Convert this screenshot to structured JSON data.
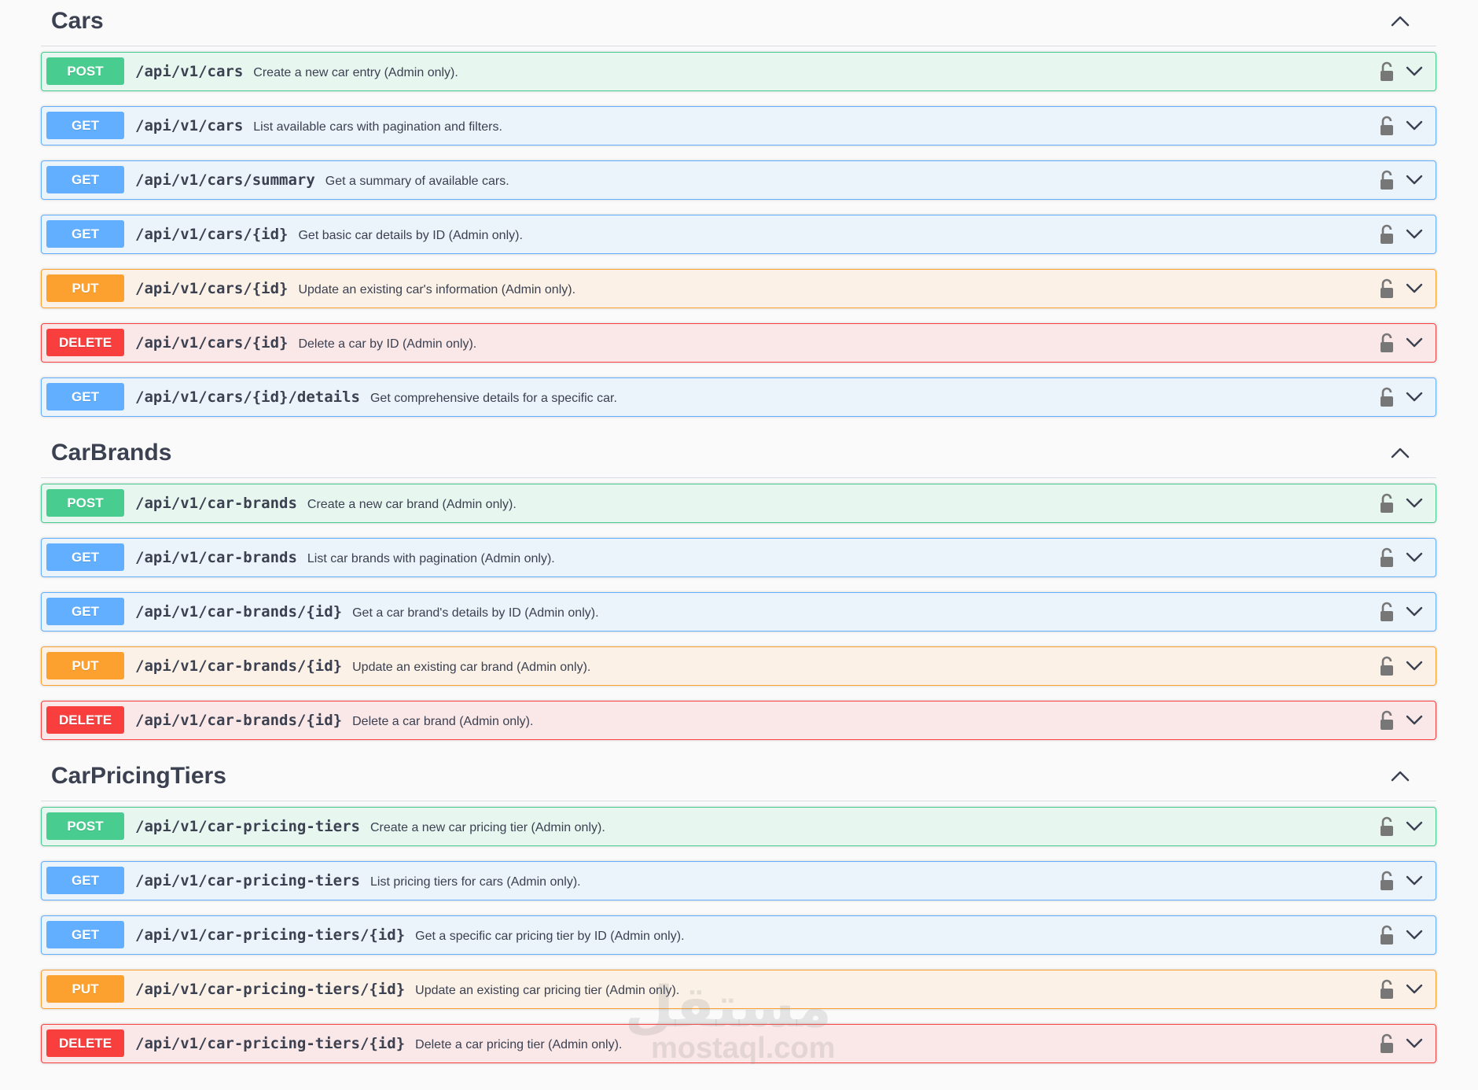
{
  "sections": [
    {
      "title": "Cars",
      "operations": [
        {
          "method": "POST",
          "type": "post",
          "path": "/api/v1/cars",
          "description": "Create a new car entry (Admin only)."
        },
        {
          "method": "GET",
          "type": "get",
          "path": "/api/v1/cars",
          "description": "List available cars with pagination and filters."
        },
        {
          "method": "GET",
          "type": "get",
          "path": "/api/v1/cars/summary",
          "description": "Get a summary of available cars."
        },
        {
          "method": "GET",
          "type": "get",
          "path": "/api/v1/cars/{id}",
          "description": "Get basic car details by ID (Admin only)."
        },
        {
          "method": "PUT",
          "type": "put",
          "path": "/api/v1/cars/{id}",
          "description": "Update an existing car's information (Admin only)."
        },
        {
          "method": "DELETE",
          "type": "delete",
          "path": "/api/v1/cars/{id}",
          "description": "Delete a car by ID (Admin only)."
        },
        {
          "method": "GET",
          "type": "get",
          "path": "/api/v1/cars/{id}/details",
          "description": "Get comprehensive details for a specific car."
        }
      ]
    },
    {
      "title": "CarBrands",
      "operations": [
        {
          "method": "POST",
          "type": "post",
          "path": "/api/v1/car-brands",
          "description": "Create a new car brand (Admin only)."
        },
        {
          "method": "GET",
          "type": "get",
          "path": "/api/v1/car-brands",
          "description": "List car brands with pagination (Admin only)."
        },
        {
          "method": "GET",
          "type": "get",
          "path": "/api/v1/car-brands/{id}",
          "description": "Get a car brand's details by ID (Admin only)."
        },
        {
          "method": "PUT",
          "type": "put",
          "path": "/api/v1/car-brands/{id}",
          "description": "Update an existing car brand (Admin only)."
        },
        {
          "method": "DELETE",
          "type": "delete",
          "path": "/api/v1/car-brands/{id}",
          "description": "Delete a car brand (Admin only)."
        }
      ]
    },
    {
      "title": "CarPricingTiers",
      "operations": [
        {
          "method": "POST",
          "type": "post",
          "path": "/api/v1/car-pricing-tiers",
          "description": "Create a new car pricing tier (Admin only)."
        },
        {
          "method": "GET",
          "type": "get",
          "path": "/api/v1/car-pricing-tiers",
          "description": "List pricing tiers for cars (Admin only)."
        },
        {
          "method": "GET",
          "type": "get",
          "path": "/api/v1/car-pricing-tiers/{id}",
          "description": "Get a specific car pricing tier by ID (Admin only)."
        },
        {
          "method": "PUT",
          "type": "put",
          "path": "/api/v1/car-pricing-tiers/{id}",
          "description": "Update an existing car pricing tier (Admin only)."
        },
        {
          "method": "DELETE",
          "type": "delete",
          "path": "/api/v1/car-pricing-tiers/{id}",
          "description": "Delete a car pricing tier (Admin only)."
        }
      ]
    }
  ],
  "watermark": {
    "arabic": "مستقل",
    "latin": "mostaql.com"
  },
  "colors": {
    "post": "#49cc90",
    "get": "#61affe",
    "put": "#fca130",
    "delete": "#f93e3e",
    "text": "#3b4151"
  },
  "icons": {
    "section_toggle": "chevron-up-icon",
    "auth": "unlocked-padlock-icon",
    "expand": "chevron-down-icon"
  }
}
